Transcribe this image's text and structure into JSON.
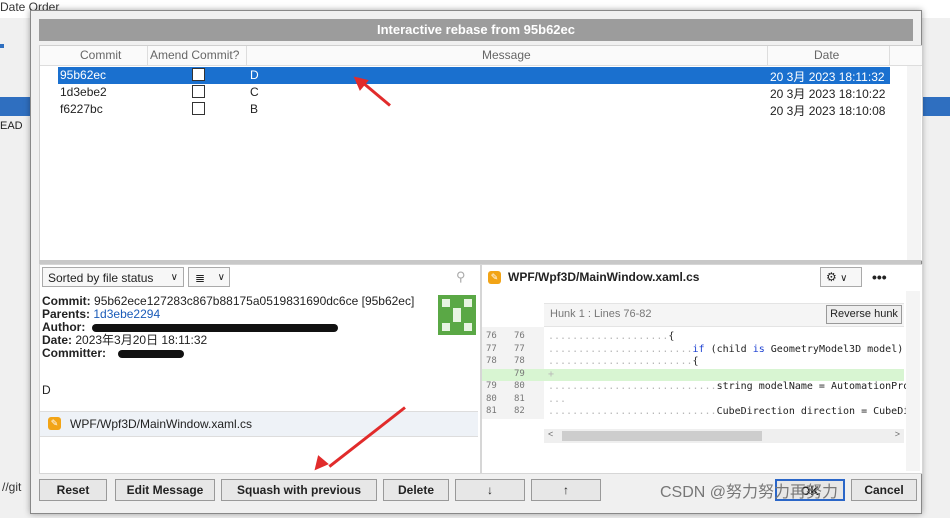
{
  "background": {
    "tab_label": "Date Order",
    "head_label": "EAD",
    "git_label": "//git"
  },
  "dialog": {
    "title": "Interactive rebase from 95b62ec",
    "columns": {
      "commit": "Commit",
      "amend": "Amend Commit?",
      "message": "Message",
      "date": "Date"
    },
    "rows": [
      {
        "commit": "95b62ec",
        "message": "D",
        "date": "20 3月 2023 18:11:32",
        "selected": true
      },
      {
        "commit": "1d3ebe2",
        "message": "C",
        "date": "20 3月 2023 18:10:22",
        "selected": false
      },
      {
        "commit": "f6227bc",
        "message": "B",
        "date": "20 3月 2023 18:10:08",
        "selected": false
      }
    ]
  },
  "left_pane": {
    "sort_label": "Sorted by file status",
    "view_icon": "≣",
    "commit_key": "Commit:",
    "commit_value": "95b62ece127283c867b88175a0519831690dc6ce [95b62ec]",
    "parents_key": "Parents:",
    "parents_value": "1d3ebe2294",
    "author_key": "Author:",
    "date_key": "Date:",
    "date_value": "2023年3月20日 18:11:32",
    "committer_key": "Committer:",
    "message": "D",
    "file": "WPF/Wpf3D/MainWindow.xaml.cs"
  },
  "right_pane": {
    "file": "WPF/Wpf3D/MainWindow.xaml.cs",
    "hunk_label": "Hunk 1 : Lines 76-82",
    "reverse_label": "Reverse hunk",
    "more_label": "•••",
    "lines": [
      {
        "n1": "76",
        "n2": "76",
        "dots": "....................",
        "code": "{",
        "type": "ctx"
      },
      {
        "n1": "77",
        "n2": "77",
        "dots": "........................",
        "code": "if (child is GeometryModel3D model)",
        "type": "ctx"
      },
      {
        "n1": "78",
        "n2": "78",
        "dots": "........................",
        "code": "{",
        "type": "ctx"
      },
      {
        "n1": "",
        "n2": "79",
        "dots": "+",
        "code": "",
        "type": "add"
      },
      {
        "n1": "79",
        "n2": "80",
        "dots": "............................",
        "code": "string modelName = AutomationProp",
        "type": "ctx"
      },
      {
        "n1": "80",
        "n2": "81",
        "dots": "...",
        "code": "",
        "type": "ctx"
      },
      {
        "n1": "81",
        "n2": "82",
        "dots": "............................",
        "code": "CubeDirection direction = CubeDir",
        "type": "ctx"
      }
    ]
  },
  "buttons": {
    "reset": "Reset",
    "edit_message": "Edit Message",
    "squash": "Squash with previous",
    "delete": "Delete",
    "down": "↓",
    "up": "↑",
    "ok": "OK",
    "cancel": "Cancel"
  },
  "watermark": "CSDN @努力努力再努力",
  "colors": {
    "selection": "#1a70cf",
    "annotation": "#e12b2b",
    "title_bar": "#9c9c9c"
  }
}
